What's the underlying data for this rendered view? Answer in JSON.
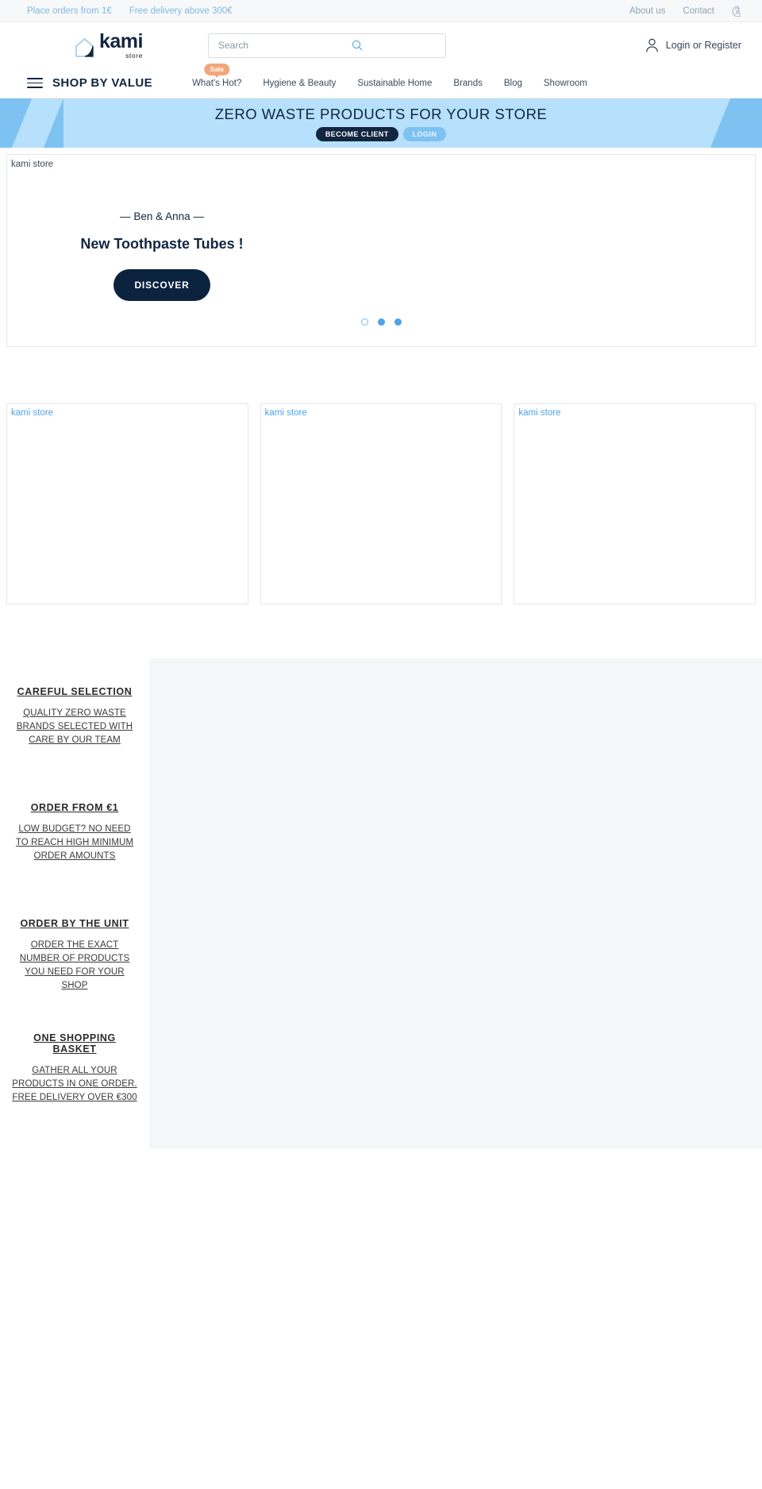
{
  "topbar": {
    "left_links": [
      {
        "label": "Place orders from 1€"
      },
      {
        "label": "Free delivery above 300€"
      }
    ],
    "right_links": [
      {
        "label": "About us"
      },
      {
        "label": "Contact"
      }
    ],
    "cart_icon": "shopping-cart-icon",
    "cart_glyph": "༊"
  },
  "header": {
    "logo": {
      "name": "kami",
      "sub": "store",
      "mark": "house-icon"
    },
    "search": {
      "value": "",
      "placeholder": "Search",
      "icon": "search-icon"
    },
    "account": {
      "label": "Login or Register",
      "icon": "user-icon"
    }
  },
  "nav": {
    "menu_icon": "hamburger-icon",
    "shop_by_value": "SHOP BY VALUE",
    "items": [
      {
        "label": "What's Hot?",
        "badge": "Sale"
      },
      {
        "label": "Hygiene & Beauty",
        "badge": ""
      },
      {
        "label": "Sustainable Home",
        "badge": ""
      },
      {
        "label": "Brands",
        "badge": ""
      },
      {
        "label": "Blog",
        "badge": ""
      },
      {
        "label": "Showroom",
        "badge": ""
      }
    ]
  },
  "promo": {
    "title": "ZERO WASTE PRODUCTS FOR YOUR STORE",
    "primary_button": "BECOME CLIENT",
    "secondary_button": "LOGIN"
  },
  "hero": {
    "alt_text": "kami store",
    "eyebrow": "— Ben & Anna —",
    "title": "New Toothpaste Tubes !",
    "button": "DISCOVER",
    "dots": [
      {
        "state": "hollow"
      },
      {
        "state": "filled"
      },
      {
        "state": "filled"
      }
    ]
  },
  "cards": [
    {
      "alt_text": "kami store"
    },
    {
      "alt_text": "kami store"
    },
    {
      "alt_text": "kami store"
    }
  ],
  "features": [
    {
      "title": "CAREFUL SELECTION",
      "text": "QUALITY ZERO WASTE BRANDS SELECTED WITH CARE BY OUR TEAM"
    },
    {
      "title": "ORDER FROM €1",
      "text": "LOW BUDGET? NO NEED TO REACH HIGH MINIMUM ORDER AMOUNTS"
    },
    {
      "title": "ORDER BY THE UNIT",
      "text": "ORDER THE EXACT NUMBER OF PRODUCTS YOU NEED FOR YOUR SHOP"
    },
    {
      "title": "ONE SHOPPING BASKET",
      "text": "GATHER ALL YOUR PRODUCTS IN ONE ORDER. FREE DELIVERY OVER €300"
    }
  ],
  "colors": {
    "brand_navy": "#12263f",
    "brand_blue": "#4da3e8",
    "promo_light": "#b6e0fb",
    "promo_dark": "#7ec2f2",
    "sale_badge": "#f2a679"
  }
}
